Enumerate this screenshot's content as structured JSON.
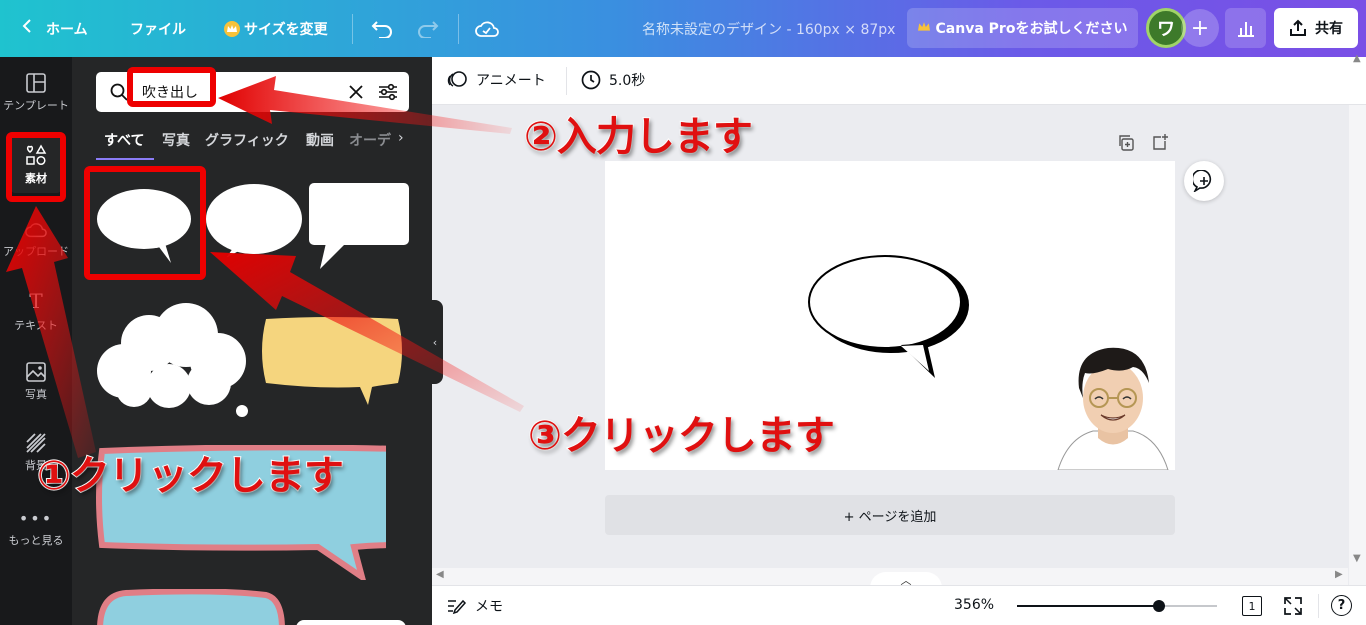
{
  "topbar": {
    "home_label": "ホーム",
    "file_label": "ファイル",
    "resize_label": "サイズを変更",
    "doc_title": "名称未設定のデザイン - 160px × 87px",
    "pro_label": "Canva Proをお試しください",
    "avatar_letter": "ワ",
    "share_label": "共有"
  },
  "rail": {
    "items": [
      {
        "label": "テンプレート"
      },
      {
        "label": "素材"
      },
      {
        "label": "アップロード"
      },
      {
        "label": "テキスト"
      },
      {
        "label": "写真"
      },
      {
        "label": "背景"
      },
      {
        "label": "もっと見る"
      }
    ]
  },
  "panel": {
    "search_value": "吹き出し",
    "tabs": [
      "すべて",
      "写真",
      "グラフィック",
      "動画",
      "オーデ"
    ]
  },
  "editor": {
    "animate_label": "アニメート",
    "duration_label": "5.0秒",
    "add_page_label": "+ ページを追加",
    "notes_label": "メモ",
    "zoom_label": "356%",
    "page_count": "1",
    "zoom_level_fraction": 0.71
  },
  "annotations": {
    "step1": "①クリックします",
    "step2": "②入力します",
    "step3": "③クリックします"
  },
  "colors": {
    "annotation_red": "#e01010",
    "accent_purple": "#8b7cf6",
    "panel_dark": "#252627",
    "rail_dark": "#18191b"
  }
}
